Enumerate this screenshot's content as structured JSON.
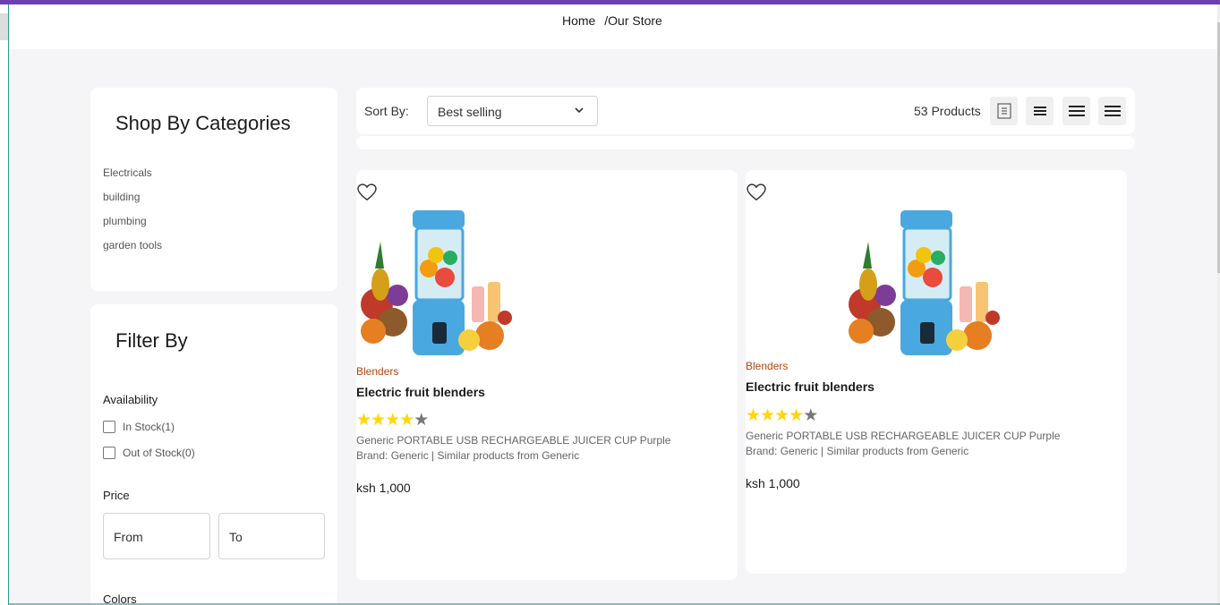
{
  "breadcrumb": {
    "home": "Home",
    "current": "/Our Store"
  },
  "categories": {
    "title": "Shop By Categories",
    "items": [
      "Electricals",
      "building",
      "plumbing",
      "garden tools"
    ]
  },
  "filter": {
    "title": "Filter By",
    "availability_label": "Availability",
    "in_stock": "In Stock(1)",
    "out_of_stock": "Out of Stock(0)",
    "price_label": "Price",
    "from_placeholder": "From",
    "to_placeholder": "To",
    "colors_label": "Colors"
  },
  "sort": {
    "label": "Sort By:",
    "selected": "Best selling"
  },
  "product_count": "53 Products",
  "grid_icons": [
    "grid-1-icon",
    "grid-2-icon",
    "grid-3-icon",
    "grid-4-icon"
  ],
  "products": [
    {
      "category": "Blenders",
      "name": "Electric fruit blenders",
      "rating": 4,
      "rating_max": 5,
      "description": "Generic PORTABLE USB RECHARGEABLE JUICER CUP Purple Brand: Generic | Similar products from Generic",
      "price": "ksh 1,000"
    },
    {
      "category": "Blenders",
      "name": "Electric fruit blenders",
      "rating": 4,
      "rating_max": 5,
      "description": "Generic PORTABLE USB RECHARGEABLE JUICER CUP Purple Brand: Generic | Similar products from Generic",
      "price": "ksh 1,000"
    }
  ],
  "colors": {
    "accent": "#6d3fb3",
    "category_text": "#b5450b",
    "star_on": "#ffd700",
    "star_off": "#777777"
  }
}
